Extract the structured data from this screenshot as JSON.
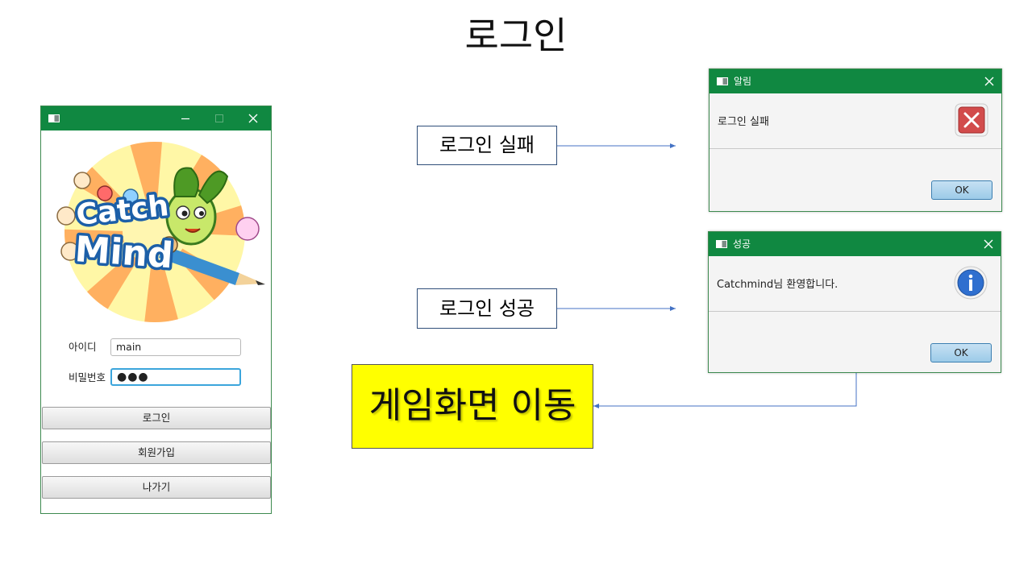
{
  "slide": {
    "title": "로그인"
  },
  "login_window": {
    "logo_text_line1": "Catch",
    "logo_text_line2": "Mind",
    "id_label": "아이디",
    "id_value": "main",
    "password_label": "비밀번호",
    "password_value": "●●●",
    "buttons": {
      "login": "로그인",
      "signup": "회원가입",
      "exit": "나가기"
    }
  },
  "labels": {
    "login_fail": "로그인 실패",
    "login_success": "로그인 성공",
    "move_to_game": "게임화면 이동"
  },
  "dialogs": {
    "fail": {
      "title": "알림",
      "message": "로그인 실패",
      "ok_label": "OK",
      "icon": "error-icon"
    },
    "success": {
      "title": "성공",
      "message": "Catchmind님 환영합니다.",
      "ok_label": "OK",
      "icon": "information-icon"
    }
  },
  "colors": {
    "titlebar": "#108841",
    "yellow_box": "#ffff00",
    "arrow": "#4472c4"
  }
}
